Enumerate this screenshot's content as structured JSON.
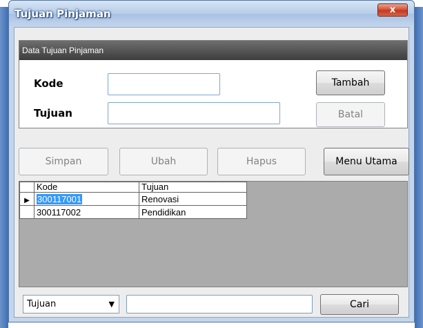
{
  "window": {
    "title": "Tujuan Pinjaman",
    "close_label": "x"
  },
  "group": {
    "header": "Data Tujuan Pinjaman"
  },
  "form": {
    "kode_label": "Kode",
    "kode_value": "",
    "tujuan_label": "Tujuan",
    "tujuan_value": ""
  },
  "buttons": {
    "tambah": "Tambah",
    "batal": "Batal",
    "simpan": "Simpan",
    "ubah": "Ubah",
    "hapus": "Hapus",
    "menu_utama": "Menu Utama",
    "cari": "Cari"
  },
  "grid": {
    "columns": [
      "Kode",
      "Tujuan"
    ],
    "rows": [
      {
        "kode": "300117001",
        "tujuan": "Renovasi",
        "selected": true
      },
      {
        "kode": "300117002",
        "tujuan": "Pendidikan",
        "selected": false
      }
    ]
  },
  "search": {
    "field_selected": "Tujuan",
    "query": ""
  },
  "icons": {
    "row_pointer": "triangle-right-icon",
    "dropdown": "chevron-down-icon",
    "close": "close-icon"
  }
}
